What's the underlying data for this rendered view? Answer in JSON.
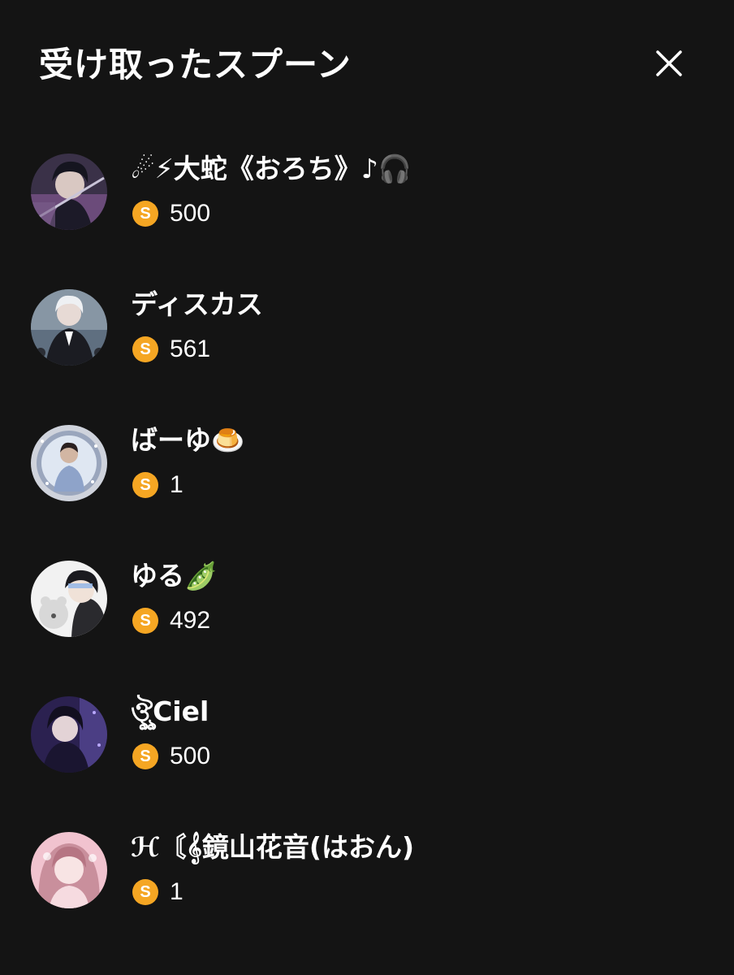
{
  "header": {
    "title": "受け取ったスプーン",
    "close_icon": "close-icon"
  },
  "colors": {
    "background": "#141414",
    "text": "#ffffff",
    "coin": "#f5a623"
  },
  "coin_letter": "S",
  "items": [
    {
      "name": "☄⚡大蛇《おろち》♪🎧",
      "amount": "500",
      "avatar": "anime-boy-dark-hair-sword"
    },
    {
      "name": "ディスカス",
      "amount": "561",
      "avatar": "anime-man-white-hair-suit"
    },
    {
      "name": "ばーゆ🍮",
      "amount": "1",
      "avatar": "anime-man-sparkle-frame"
    },
    {
      "name": "ゆる🫛",
      "amount": "492",
      "avatar": "anime-boy-with-bear"
    },
    {
      "name": "ঔৣCiel",
      "amount": "500",
      "avatar": "anime-boy-purple-glow"
    },
    {
      "name": "ℋ〘𝄞鏡山花音(はおん)",
      "amount": "1",
      "avatar": "pink-girl-photo"
    }
  ]
}
